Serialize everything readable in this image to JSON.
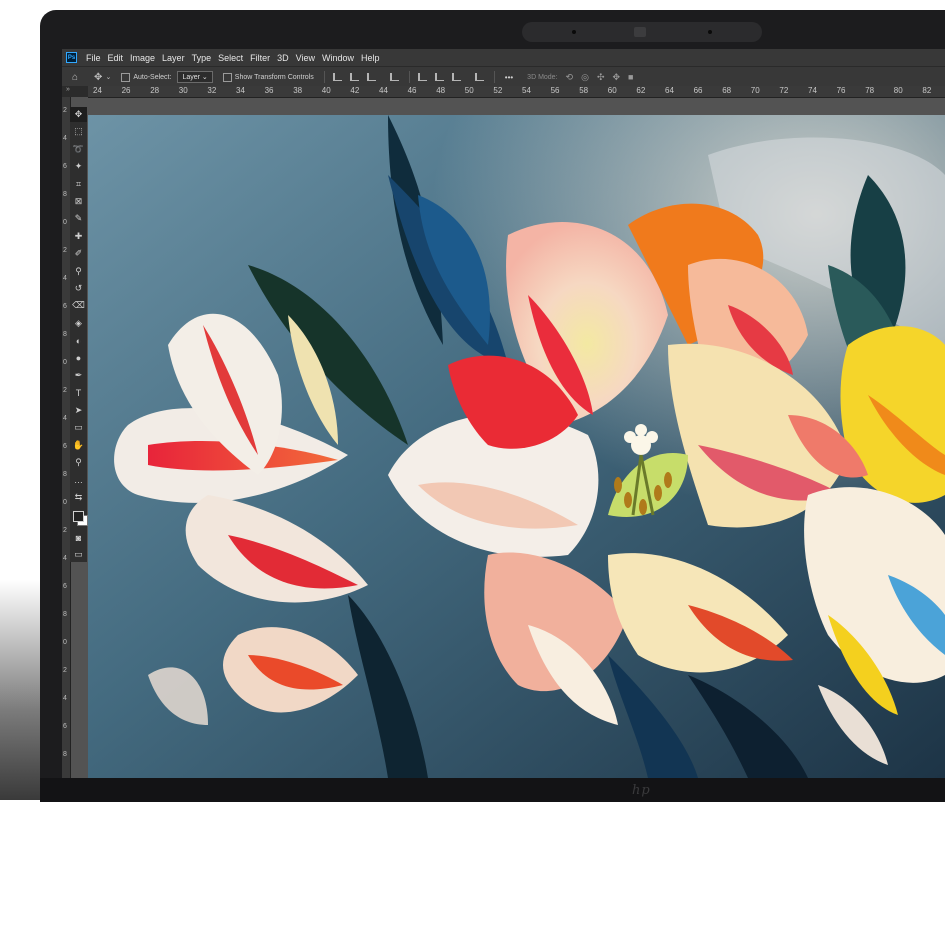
{
  "app": {
    "logo_text": "Ps",
    "menu": [
      "File",
      "Edit",
      "Image",
      "Layer",
      "Type",
      "Select",
      "Filter",
      "3D",
      "View",
      "Window",
      "Help"
    ]
  },
  "options_bar": {
    "home_icon": "home-icon",
    "move_icon": "move-icon",
    "auto_select_label": "Auto-Select:",
    "auto_select_value": "Layer",
    "auto_select_checked": false,
    "show_transform_label": "Show Transform Controls",
    "show_transform_checked": false,
    "more_label": "•••",
    "three_d_label": "3D Mode:"
  },
  "ruler": {
    "tab_arrow": "»",
    "horizontal_ticks": [
      "24",
      "26",
      "28",
      "30",
      "32",
      "34",
      "36",
      "38",
      "40",
      "42",
      "44",
      "46",
      "48",
      "50",
      "52",
      "54",
      "56",
      "58",
      "60",
      "62",
      "64",
      "66",
      "68",
      "70",
      "72",
      "74",
      "76",
      "78",
      "80",
      "82"
    ],
    "vertical_ticks": [
      "2",
      "4",
      "6",
      "8",
      "0",
      "2",
      "4",
      "6",
      "8",
      "0",
      "2",
      "4",
      "6",
      "8",
      "0",
      "2",
      "4",
      "6",
      "8",
      "0",
      "2",
      "4",
      "6",
      "8"
    ]
  },
  "toolbar": {
    "tools": [
      {
        "name": "move-tool-icon",
        "glyph": "✥"
      },
      {
        "name": "marquee-tool-icon",
        "glyph": "⬚"
      },
      {
        "name": "lasso-tool-icon",
        "glyph": "➰"
      },
      {
        "name": "magic-wand-tool-icon",
        "glyph": "✦"
      },
      {
        "name": "crop-tool-icon",
        "glyph": "⌗"
      },
      {
        "name": "frame-tool-icon",
        "glyph": "⊠"
      },
      {
        "name": "eyedropper-tool-icon",
        "glyph": "✎"
      },
      {
        "name": "healing-brush-tool-icon",
        "glyph": "✚"
      },
      {
        "name": "brush-tool-icon",
        "glyph": "✐"
      },
      {
        "name": "clone-stamp-tool-icon",
        "glyph": "⚲"
      },
      {
        "name": "history-brush-tool-icon",
        "glyph": "↺"
      },
      {
        "name": "eraser-tool-icon",
        "glyph": "⌫"
      },
      {
        "name": "paint-bucket-tool-icon",
        "glyph": "◈"
      },
      {
        "name": "blur-tool-icon",
        "glyph": "◐"
      },
      {
        "name": "dodge-tool-icon",
        "glyph": "●"
      },
      {
        "name": "pen-tool-icon",
        "glyph": "✒"
      },
      {
        "name": "type-tool-icon",
        "glyph": "T"
      },
      {
        "name": "path-selection-tool-icon",
        "glyph": "➤"
      },
      {
        "name": "rectangle-tool-icon",
        "glyph": "▭"
      },
      {
        "name": "hand-tool-icon",
        "glyph": "✋"
      },
      {
        "name": "zoom-tool-icon",
        "glyph": "⚲"
      },
      {
        "name": "more-tools-icon",
        "glyph": "…"
      },
      {
        "name": "default-colors-icon",
        "glyph": "⇆"
      }
    ],
    "quick_mask_icon": "quick-mask-icon",
    "screen_mode_icon": "screen-mode-icon",
    "foreground_color": "#222222",
    "background_color": "#ffffff"
  },
  "hardware": {
    "brand_mark": "hp"
  },
  "colors": {
    "menubar": "#383838",
    "workspace": "#535353",
    "bezel": "#1c1c1e",
    "canvas_background": "#4a7388"
  }
}
